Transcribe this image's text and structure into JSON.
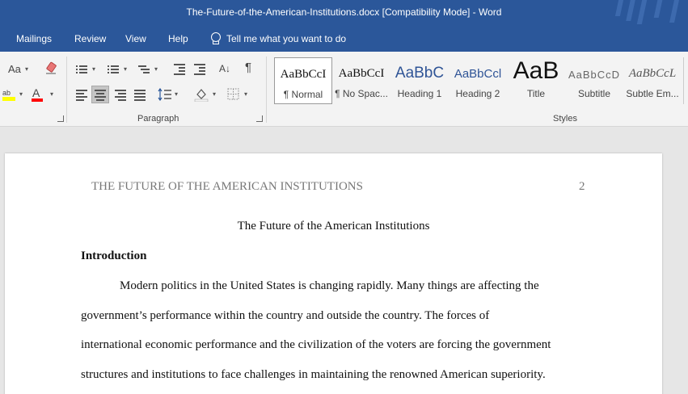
{
  "window": {
    "title": "The-Future-of-the-American-Institutions.docx [Compatibility Mode]  -  Word",
    "accent_color": "#2b579a"
  },
  "tabs": [
    {
      "label": "Mailings"
    },
    {
      "label": "Review"
    },
    {
      "label": "View"
    },
    {
      "label": "Help"
    }
  ],
  "tell_me": {
    "placeholder": "Tell me what you want to do",
    "icon": "lightbulb-icon"
  },
  "ribbon": {
    "font_group": {
      "change_case_label": "Aa",
      "clear_format_icon": "eraser-icon",
      "highlight_icon": "highlighter-icon",
      "highlight_color": "#ffff00",
      "font_color_label": "A",
      "font_color": "#ff0000"
    },
    "paragraph_group": {
      "label": "Paragraph",
      "sort_icon": "sort-az-icon",
      "sort_label": "A↓",
      "pilcrow": "¶"
    },
    "styles_group": {
      "label": "Styles",
      "items": [
        {
          "sample": "AaBbCcI",
          "name": "¶ Normal"
        },
        {
          "sample": "AaBbCcI",
          "name": "¶ No Spac..."
        },
        {
          "sample": "AaBbC",
          "name": "Heading 1"
        },
        {
          "sample": "AaBbCcl",
          "name": "Heading 2"
        },
        {
          "sample": "AaB",
          "name": "Title"
        },
        {
          "sample": "AaBbCcD",
          "name": "Subtitle"
        },
        {
          "sample": "AaBbCcL",
          "name": "Subtle Em..."
        }
      ]
    }
  },
  "document": {
    "running_head": "THE FUTURE OF THE AMERICAN INSTITUTIONS",
    "page_number": "2",
    "title": "The Future of the American Institutions",
    "heading": "Introduction",
    "paragraph_lines": [
      "Modern politics in the United States is changing rapidly. Many things are affecting the",
      "government’s performance within the country and outside the country. The forces of",
      "international economic performance and the civilization of the voters are forcing the government",
      "structures and institutions to face challenges in maintaining the renowned American superiority."
    ]
  }
}
